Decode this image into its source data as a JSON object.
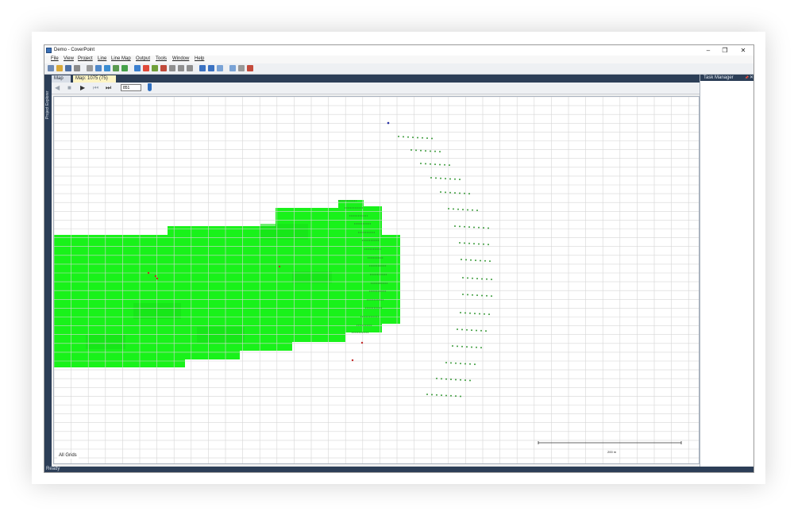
{
  "window": {
    "title": "Demo - CoverPoint",
    "minimize_glyph": "–",
    "restore_glyph": "❐",
    "close_glyph": "✕"
  },
  "menu": {
    "items": [
      {
        "label": "File"
      },
      {
        "label": "View"
      },
      {
        "label": "Project"
      },
      {
        "label": "Line"
      },
      {
        "label": "Line Map"
      },
      {
        "label": "Output"
      },
      {
        "label": "Tools"
      },
      {
        "label": "Window"
      },
      {
        "label": "Help"
      }
    ]
  },
  "toolbar": {
    "buttons": [
      {
        "icon": "new-icon",
        "color": "#6e8bb5"
      },
      {
        "icon": "open-icon",
        "color": "#d9a93a"
      },
      {
        "icon": "save-icon",
        "color": "#4c6fa3"
      },
      {
        "icon": "print-icon",
        "color": "#8a8a8a"
      },
      {
        "icon": "cut-icon",
        "color": "#9a9a9a"
      },
      {
        "icon": "copy-icon",
        "color": "#4f88c9"
      },
      {
        "icon": "globe-icon",
        "color": "#3b8dd1"
      },
      {
        "icon": "grid-icon",
        "color": "#5a9a4f"
      },
      {
        "icon": "layers-icon",
        "color": "#46a14a"
      },
      {
        "icon": "line-icon",
        "color": "#3a7fcf"
      },
      {
        "icon": "chart-icon",
        "color": "#e04a3a"
      },
      {
        "icon": "table-icon",
        "color": "#6f9f3a"
      },
      {
        "icon": "export-icon",
        "color": "#c04a3a"
      },
      {
        "icon": "arrow-icon",
        "color": "#8f8f8f"
      },
      {
        "icon": "undo-icon",
        "color": "#8f8f8f"
      },
      {
        "icon": "redo-icon",
        "color": "#8f8f8f"
      },
      {
        "icon": "help-icon",
        "color": "#3b72c2"
      },
      {
        "icon": "settings-icon",
        "color": "#3b72c2"
      },
      {
        "icon": "zoom-icon",
        "color": "#7aa3d6"
      },
      {
        "icon": "ruler-icon",
        "color": "#7aa3d6"
      },
      {
        "icon": "filter-icon",
        "color": "#999999"
      },
      {
        "icon": "tag-icon",
        "color": "#c44b3c"
      }
    ]
  },
  "dock_left": {
    "label": "Project Explorer"
  },
  "tabs": {
    "map": "Map",
    "map_1075": "Map: 1075 (75)",
    "close_glyph": "✕"
  },
  "playback": {
    "rewind_glyph": "◀",
    "stop_glyph": "■",
    "play_glyph": "▶",
    "prev_glyph": "⏮",
    "next_glyph": "⏭",
    "frame_value": "851"
  },
  "map": {
    "layer_label": "All Grids",
    "scale_label": "200 m",
    "coverage_color": "#19f21a",
    "coverage_color_dark": "#16e017",
    "grid_color": "#d6d6d6",
    "source_color": "#2c8f2c",
    "receiver_color": "#3a9a3a",
    "marker_color": "#c42b2b"
  },
  "task_manager": {
    "title": "Task Manager",
    "pin_glyph": "📌",
    "close_glyph": "✕"
  },
  "status": {
    "text": "Ready"
  }
}
